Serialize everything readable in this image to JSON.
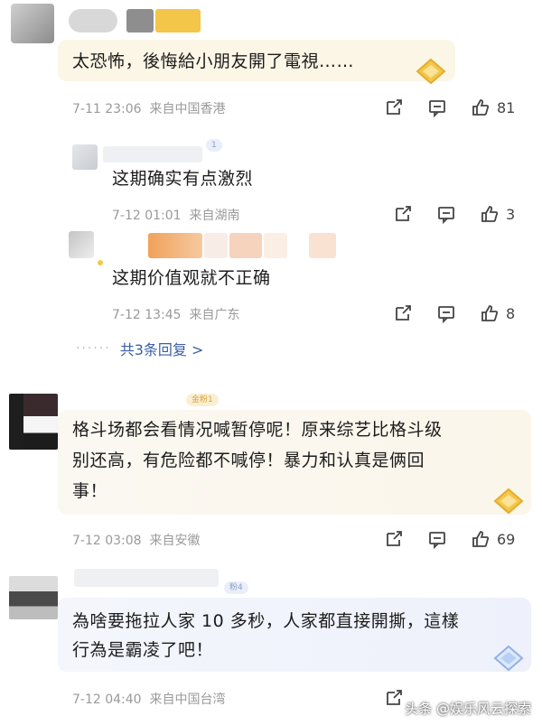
{
  "comments": [
    {
      "text": "太恐怖，後悔給小朋友開了電視……",
      "time": "7-11 23:06",
      "location": "来自中国香港",
      "likes": "81"
    },
    {
      "text": "这期确实有点激烈",
      "time": "7-12 01:01",
      "location": "来自湖南",
      "likes": "3",
      "badge": "1"
    },
    {
      "text": "这期价值观就不正确",
      "time": "7-12 13:45",
      "location": "来自广东",
      "likes": "8"
    },
    {
      "text_line1": "格斗场都会看情况喊暂停呢！原来综艺比格斗级",
      "text_line2": "别还高，有危险都不喊停！暴力和认真是俩回",
      "text_line3": "事！",
      "time": "7-12 03:08",
      "location": "来自安徽",
      "likes": "69",
      "badge": "金粉1"
    },
    {
      "text_line1": "為啥要拖拉人家 10 多秒，人家都直接開撕，這樣",
      "text_line2": "行為是霸凌了吧！",
      "time": "7-12 04:40",
      "location": "来自中国台湾",
      "badge": "粉4"
    }
  ],
  "replies_link": "共3条回复 >",
  "watermark": "头条 @娱乐风云探索",
  "colors": {
    "bubble": "#fbf7ec",
    "bubble_blue": "#f1f3fb",
    "link": "#3a5fa8",
    "meta": "#9a9a9a"
  }
}
